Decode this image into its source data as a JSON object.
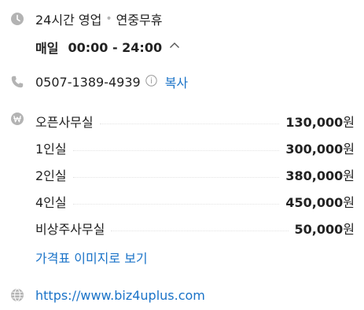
{
  "hours": {
    "status": "24시간 영업",
    "separator": "•",
    "note": "연중무휴",
    "day": "매일",
    "time": "00:00 - 24:00",
    "chevron": "^"
  },
  "phone": {
    "number": "0507-1389-4939",
    "info_icon": "i",
    "copy_label": "복사"
  },
  "prices": {
    "items": [
      {
        "name": "오픈사무실",
        "price": "130,000",
        "unit": "원"
      },
      {
        "name": "1인실",
        "price": "300,000",
        "unit": "원"
      },
      {
        "name": "2인실",
        "price": "380,000",
        "unit": "원"
      },
      {
        "name": "4인실",
        "price": "450,000",
        "unit": "원"
      },
      {
        "name": "비상주사무실",
        "price": "50,000",
        "unit": "원"
      }
    ],
    "image_link": "가격표 이미지로 보기"
  },
  "website": {
    "url": "https://www.biz4uplus.com"
  },
  "icons": [
    "clock-icon",
    "phone-icon",
    "won-icon",
    "globe-icon"
  ],
  "colors": {
    "link": "#1a73c8",
    "icon": "#b3b3b3",
    "text": "#222222"
  }
}
